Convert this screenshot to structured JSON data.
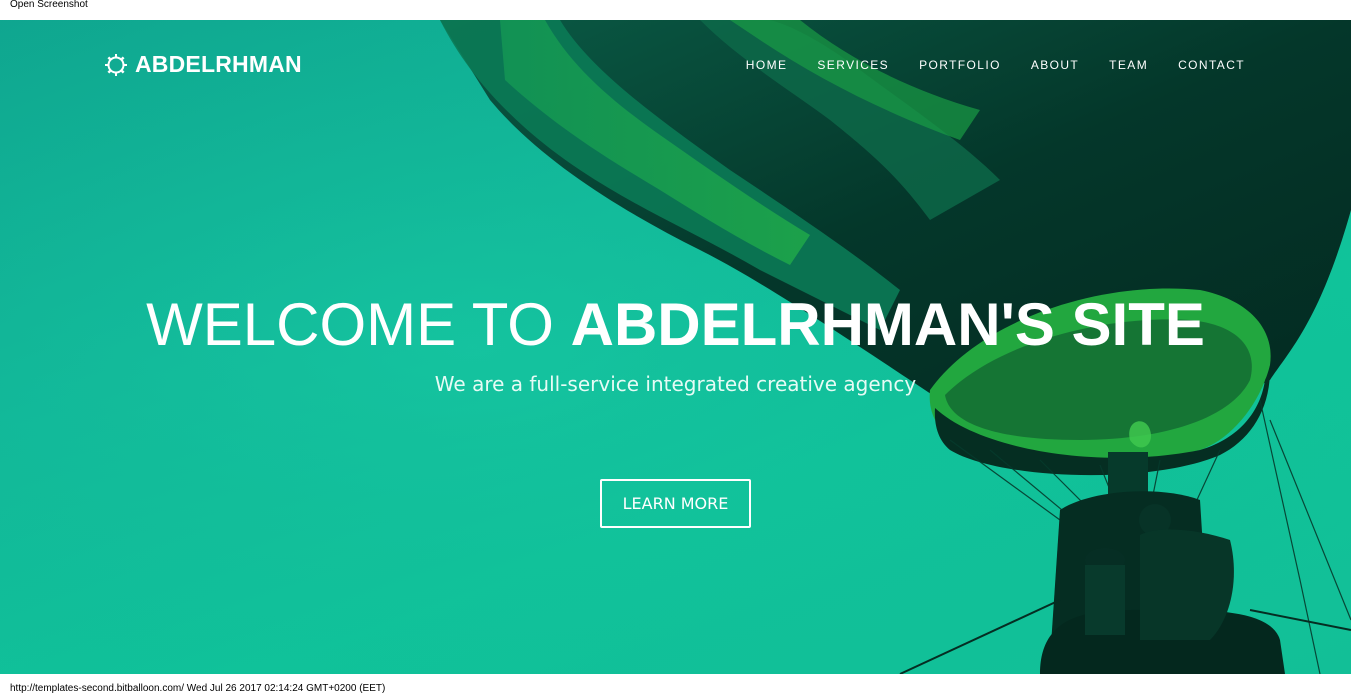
{
  "screenshot": {
    "top_caption": "Open Screenshot",
    "bottom_caption": "http://templates-second.bitballoon.com/ Wed Jul 26 2017 02:14:24 GMT+0200 (EET)"
  },
  "nav": {
    "brand": {
      "icon": "gear-icon",
      "name": "ABDELRHMAN"
    },
    "items": [
      {
        "label": "HOME"
      },
      {
        "label": "SERVICES"
      },
      {
        "label": "PORTFOLIO"
      },
      {
        "label": "ABOUT"
      },
      {
        "label": "TEAM"
      },
      {
        "label": "CONTACT"
      }
    ]
  },
  "hero": {
    "headline_light": "WELCOME TO ",
    "headline_bold": "ABDELRHMAN'S SITE",
    "subheadline": "We are a full-service integrated creative agency",
    "cta_label": "LEARN MORE",
    "background_image": "hot-air-balloon"
  },
  "colors": {
    "hero_teal": "#12b899",
    "balloon_dark": "#05362a",
    "balloon_green": "#1fa84a",
    "text": "#ffffff"
  }
}
